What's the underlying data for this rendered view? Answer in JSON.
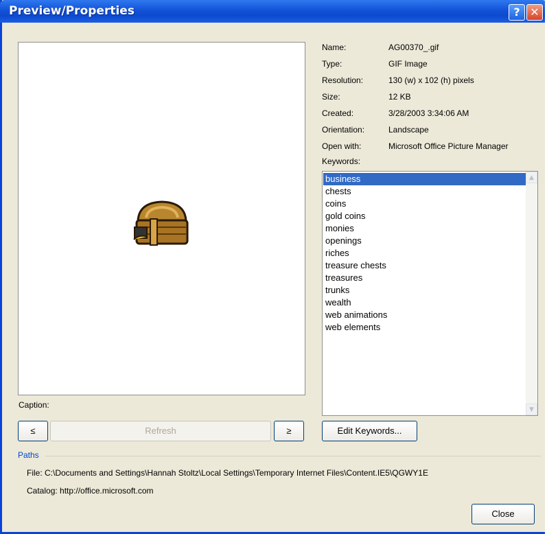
{
  "window": {
    "title": "Preview/Properties",
    "help_glyph": "?",
    "close_glyph": "✕"
  },
  "properties": [
    {
      "label": "Name:",
      "value": "AG00370_.gif"
    },
    {
      "label": "Type:",
      "value": "GIF Image"
    },
    {
      "label": "Resolution:",
      "value": "130 (w) x 102 (h) pixels"
    },
    {
      "label": "Size:",
      "value": "12 KB"
    },
    {
      "label": "Created:",
      "value": "3/28/2003 3:34:06 AM"
    },
    {
      "label": "Orientation:",
      "value": "Landscape"
    },
    {
      "label": "Open with:",
      "value": "Microsoft Office Picture Manager"
    }
  ],
  "keywords": {
    "label": "Keywords:",
    "items": [
      "business",
      "chests",
      "coins",
      "gold coins",
      "monies",
      "openings",
      "riches",
      "treasure chests",
      "treasures",
      "trunks",
      "wealth",
      "web animations",
      "web elements"
    ],
    "selected": "business"
  },
  "caption": {
    "label": "Caption:"
  },
  "buttons": {
    "prev": "≤",
    "refresh": "Refresh",
    "next": "≥",
    "edit_keywords": "Edit Keywords...",
    "close": "Close"
  },
  "paths": {
    "label": "Paths",
    "file": "File: C:\\Documents and Settings\\Hannah Stoltz\\Local Settings\\Temporary Internet Files\\Content.IE5\\QGWY1E",
    "catalog": "Catalog: http://office.microsoft.com"
  },
  "colors": {
    "title_bar": "#0c49cf",
    "selection": "#316ac5",
    "paths_label": "#0046d5"
  },
  "preview_image": "treasure-chest"
}
